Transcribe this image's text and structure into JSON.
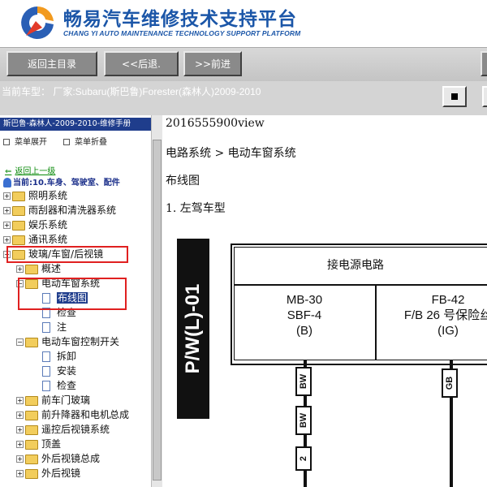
{
  "header": {
    "title": "畅易汽车维修技术支持平台",
    "subtitle": "CHANG YI AUTO MAINTENANCE TECHNOLOGY SUPPORT PLATFORM"
  },
  "toolbar": {
    "home_label": "返回主目录",
    "back_label": "<<后退.",
    "forward_label": ">>前进"
  },
  "infobar": {
    "car_text": "当前车型： 厂家:Subaru(斯巴鲁)Forester(森林人)2009-2010"
  },
  "sidebar": {
    "title": "斯巴鲁-森林人-2009-2010-维修手册",
    "expand_label": "菜单展开",
    "collapse_label": "菜单折叠",
    "back_link": "返回上一级",
    "current": "当前:10.车身、驾驶室、配件",
    "items": [
      {
        "label": "照明系统",
        "type": "folder"
      },
      {
        "label": "雨刮器和清洗器系统",
        "type": "folder"
      },
      {
        "label": "娱乐系统",
        "type": "folder"
      },
      {
        "label": "通讯系统",
        "type": "folder"
      },
      {
        "label": "玻璃/车窗/后视镜",
        "type": "folder"
      },
      {
        "label": "概述",
        "type": "folder"
      },
      {
        "label": "电动车窗系统",
        "type": "folder"
      },
      {
        "label": "布线图",
        "type": "doc"
      },
      {
        "label": "检查",
        "type": "doc"
      },
      {
        "label": "注",
        "type": "doc"
      },
      {
        "label": "电动车窗控制开关",
        "type": "folder"
      },
      {
        "label": "拆卸",
        "type": "doc"
      },
      {
        "label": "安装",
        "type": "doc"
      },
      {
        "label": "检查",
        "type": "doc"
      },
      {
        "label": "前车门玻璃",
        "type": "folder"
      },
      {
        "label": "前升降器和电机总成",
        "type": "folder"
      },
      {
        "label": "遥控后视镜系统",
        "type": "folder"
      },
      {
        "label": "顶盖",
        "type": "folder"
      },
      {
        "label": "外后视镜总成",
        "type": "folder"
      },
      {
        "label": "外后视镜",
        "type": "folder"
      }
    ]
  },
  "content": {
    "id_line": "2016555900view",
    "breadcrumb": "电路系统 > 电动车窗系统",
    "section": "布线图",
    "subsection": "1. 左驾车型",
    "diagram": {
      "side_label": "P/W(L)-01",
      "frame_title": "接电源电路",
      "left_connector": [
        "MB-30",
        "SBF-4",
        "(B)"
      ],
      "right_connector": [
        "FB-42",
        "F/B 26 号保险丝",
        "(IG)"
      ],
      "wire_tags": [
        "BW",
        "BW",
        "GB"
      ],
      "pin": "2"
    }
  }
}
